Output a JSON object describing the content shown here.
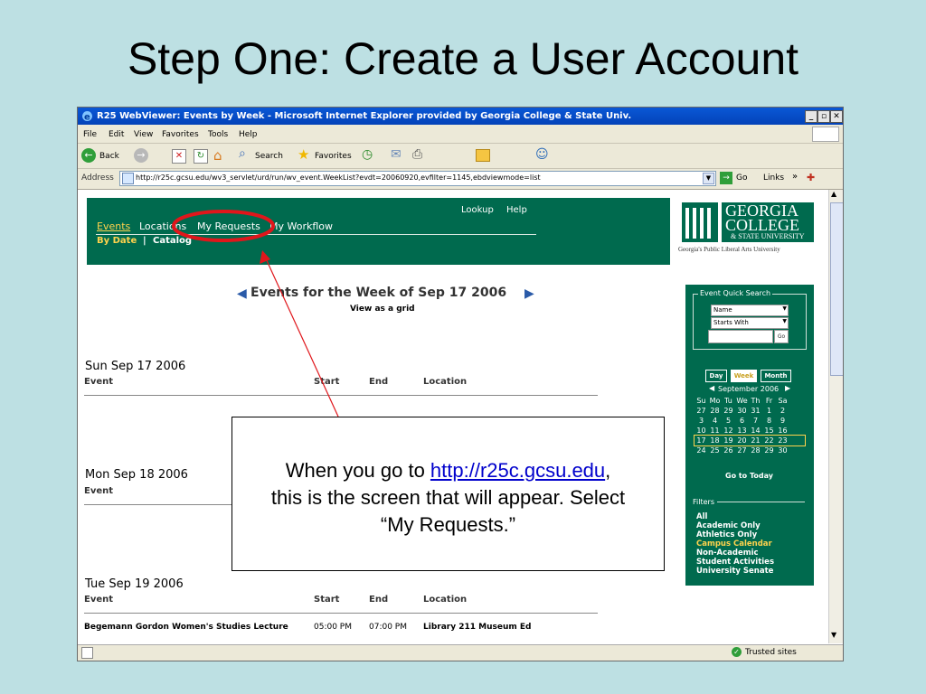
{
  "slide": {
    "title": "Step One:  Create a User Account"
  },
  "browser": {
    "title": "R25 WebViewer: Events by Week - Microsoft Internet Explorer provided by Georgia College & State Univ.",
    "menu": [
      "File",
      "Edit",
      "View",
      "Favorites",
      "Tools",
      "Help"
    ],
    "toolbar": {
      "back": "Back",
      "search": "Search",
      "favorites": "Favorites"
    },
    "address_label": "Address",
    "url": "http://r25c.gcsu.edu/wv3_servlet/urd/run/wv_event.WeekList?evdt=20060920,evfilter=1145,ebdviewmode=list",
    "go": "Go",
    "links": "Links",
    "status": "Trusted sites"
  },
  "app": {
    "nav": [
      "Events",
      "Locations",
      "My Requests",
      "My Workflow"
    ],
    "right_nav": [
      "Lookup",
      "Help"
    ],
    "subnav": [
      "By Date",
      "Catalog"
    ],
    "subnav_sep": "|",
    "logo": {
      "line1": "GEORGIA",
      "line2": "COLLEGE",
      "line3": "& STATE UNIVERSITY",
      "tagline": "Georgia's Public Liberal Arts University"
    },
    "week_title": "Events for the Week of Sep 17 2006",
    "view_grid": "View as a grid",
    "columns": {
      "event": "Event",
      "start": "Start",
      "end": "End",
      "location": "Location"
    },
    "days": [
      {
        "date": "Sun Sep 17 2006"
      },
      {
        "date": "Mon Sep 18 2006"
      },
      {
        "date": "Tue Sep 19 2006"
      }
    ],
    "event_row": {
      "name": "Begemann Gordon Women's Studies Lecture",
      "start": "05:00 PM",
      "end": "07:00 PM",
      "location": "Library 211 Museum Ed"
    }
  },
  "sidebar": {
    "quick_search_legend": "Event Quick Search",
    "select1": "Name",
    "select2": "Starts With",
    "go": "Go",
    "view_buttons": [
      "Day",
      "Week",
      "Month"
    ],
    "month": "September 2006",
    "weekdays": [
      "Su",
      "Mo",
      "Tu",
      "We",
      "Th",
      "Fr",
      "Sa"
    ],
    "weeks": [
      [
        "27",
        "28",
        "29",
        "30",
        "31",
        "1",
        "2"
      ],
      [
        "3",
        "4",
        "5",
        "6",
        "7",
        "8",
        "9"
      ],
      [
        "10",
        "11",
        "12",
        "13",
        "14",
        "15",
        "16"
      ],
      [
        "17",
        "18",
        "19",
        "20",
        "21",
        "22",
        "23"
      ],
      [
        "24",
        "25",
        "26",
        "27",
        "28",
        "29",
        "30"
      ]
    ],
    "go_today": "Go to Today",
    "filters_legend": "Filters",
    "filters": [
      "All",
      "Academic Only",
      "Athletics Only",
      "Campus Calendar",
      "Non-Academic",
      "Student Activities",
      "University Senate"
    ]
  },
  "callout": {
    "pre": "When you go to ",
    "link": "http://r25c.gcsu.edu",
    "post": ",",
    "line2": "this is the screen that will appear.  Select",
    "line3": "“My Requests.”"
  },
  "colors": {
    "background": "#bde0e3",
    "brand_green": "#006a4e",
    "highlight_red": "#e0161b",
    "link_yellow": "#ffd34d"
  }
}
